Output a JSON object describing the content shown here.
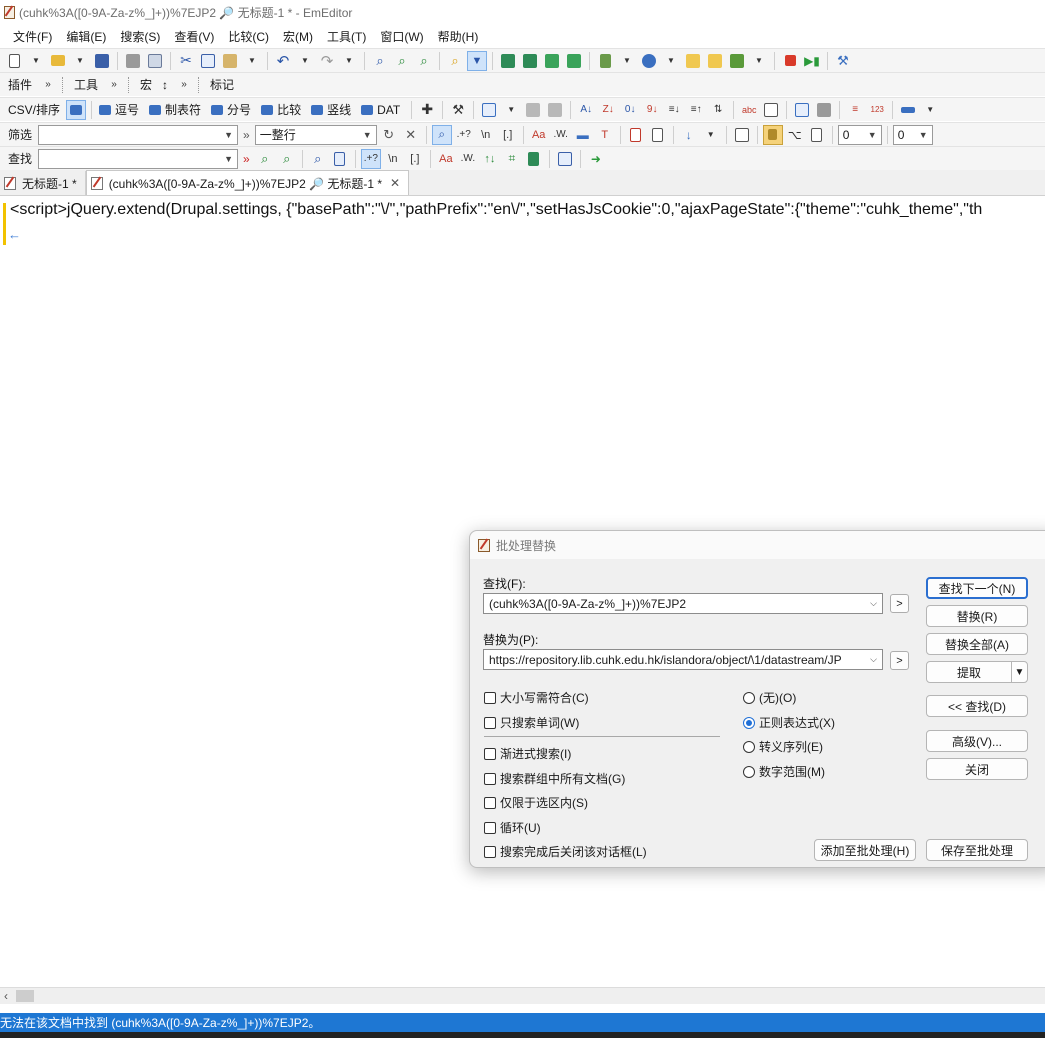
{
  "window": {
    "title": "(cuhk%3A([0-9A-Za-z%_]+))%7EJP2 🔎 无标题-1 * - EmEditor"
  },
  "menu": [
    "文件(F)",
    "编辑(E)",
    "搜索(S)",
    "查看(V)",
    "比较(C)",
    "宏(M)",
    "工具(T)",
    "窗口(W)",
    "帮助(H)"
  ],
  "toolbar3": {
    "plugins": "插件",
    "tools": "工具",
    "macro": "宏",
    "macro_sub": "↕",
    "marks": "标记"
  },
  "csvbar": {
    "csv_sort": "CSV/排序",
    "comma": "逗号",
    "tab": "制表符",
    "semicolon": "分号",
    "compare": "比较",
    "vertical": "竖线",
    "dat": "DAT"
  },
  "filterbar": {
    "label": "筛选",
    "value": "",
    "scope": "一整行",
    "num1": "0",
    "num2": "0"
  },
  "findbar": {
    "label": "查找",
    "value": ""
  },
  "tabs": [
    {
      "label": "无标题-1 *"
    },
    {
      "label": "(cuhk%3A([0-9A-Za-z%_]+))%7EJP2 🔎 无标题-1 *"
    }
  ],
  "editor": {
    "line1": "<script>jQuery.extend(Drupal.settings, {\"basePath\":\"\\/\",\"pathPrefix\":\"en\\/\",\"setHasJsCookie\":0,\"ajaxPageState\":{\"theme\":\"cuhk_theme\",\"th",
    "eol_mark": "←"
  },
  "status": {
    "message": "无法在该文档中找到 (cuhk%3A([0-9A-Za-z%_]+))%7EJP2。"
  },
  "dialog": {
    "title": "批处理替换",
    "find_label": "查找(F):",
    "find_value": "(cuhk%3A([0-9A-Za-z%_]+))%7EJP2",
    "replace_label": "替换为(P):",
    "replace_value": "https://repository.lib.cuhk.edu.hk/islandora/object/\\1/datastream/JP",
    "more": ">",
    "options": {
      "match_case": "大小写需符合(C)",
      "whole_word": "只搜索单词(W)",
      "incremental": "渐进式搜索(I)",
      "all_docs": "搜索群组中所有文档(G)",
      "selection_only": "仅限于选区内(S)",
      "loop": "循环(U)",
      "close_after": "搜索完成后关闭该对话框(L)"
    },
    "modes": {
      "none": "(无)(O)",
      "regex": "正则表达式(X)",
      "escape": "转义序列(E)",
      "numeric": "数字范围(M)"
    },
    "buttons": {
      "find_next": "查找下一个(N)",
      "replace": "替换(R)",
      "replace_all": "替换全部(A)",
      "extract": "提取",
      "find_collapse": "<< 查找(D)",
      "advanced": "高级(V)...",
      "close": "关闭",
      "add_batch": "添加至批处理(H)",
      "save_batch": "保存至批处理"
    }
  }
}
